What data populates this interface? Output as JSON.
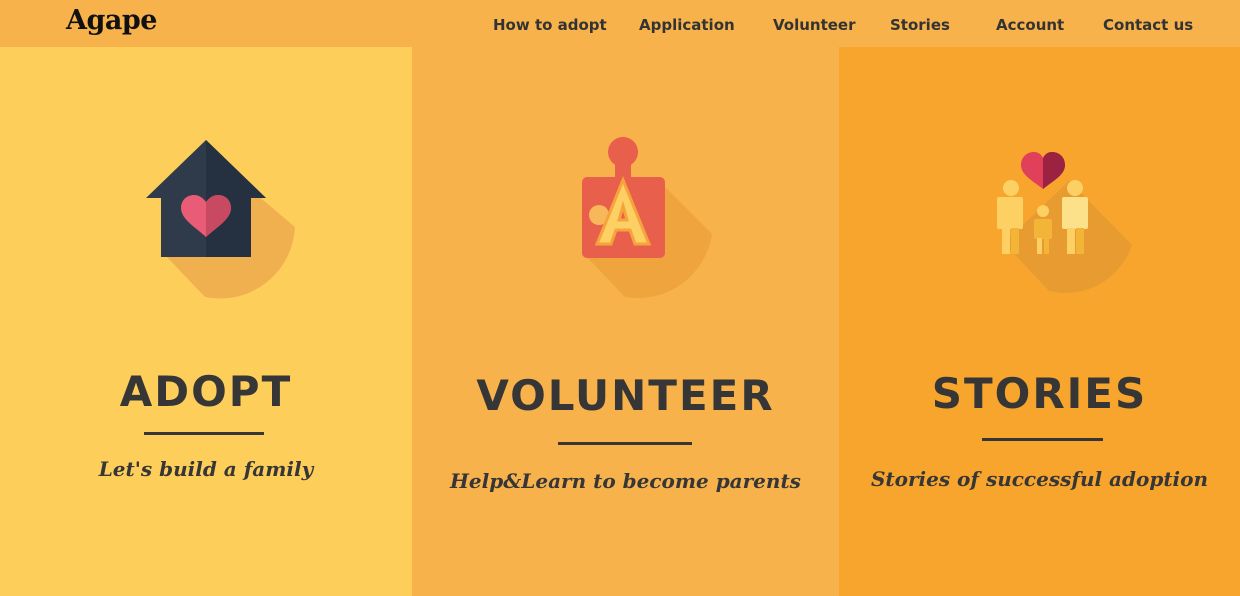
{
  "nav": {
    "logo": "Agape",
    "items": [
      {
        "label": "How to adopt"
      },
      {
        "label": "Application"
      },
      {
        "label": "Volunteer"
      },
      {
        "label": "Stories"
      },
      {
        "label": "Account"
      },
      {
        "label": "Contact us"
      }
    ]
  },
  "panels": [
    {
      "title": "ADOPT",
      "subtitle": "Let's build a family",
      "icon": "house-heart-icon",
      "bg": "#fece5a"
    },
    {
      "title": "VOLUNTEER",
      "subtitle": "Help&Learn to become parents",
      "icon": "puzzle-letter-icon",
      "bg": "#f7b24c"
    },
    {
      "title": "STORIES",
      "subtitle": "Stories of successful adoption",
      "icon": "family-heart-icon",
      "bg": "#f8a52e"
    }
  ],
  "colors": {
    "nav_bg": "#f7b24c",
    "text_dark": "#363636",
    "heart_red": "#e0405a"
  }
}
